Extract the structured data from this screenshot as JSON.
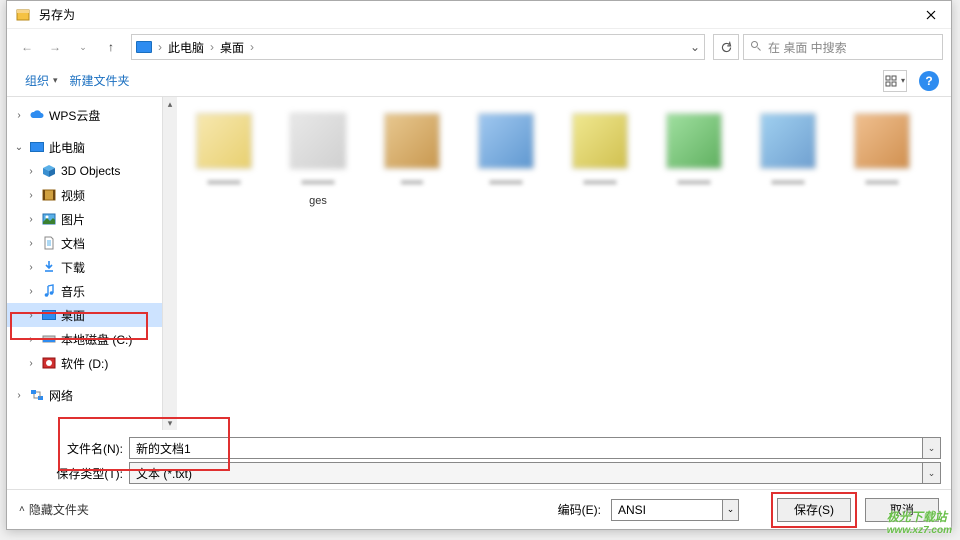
{
  "window": {
    "title": "另存为"
  },
  "breadcrumb": {
    "root": "此电脑",
    "current": "桌面"
  },
  "search": {
    "placeholder": "在 桌面 中搜索"
  },
  "toolbar": {
    "organize": "组织",
    "new_folder": "新建文件夹"
  },
  "sidebar": {
    "items": [
      {
        "label": "WPS云盘",
        "level": 0,
        "exp": "›",
        "icon": "cloud",
        "selected": false
      },
      {
        "label": "此电脑",
        "level": 0,
        "exp": "⌄",
        "icon": "pc",
        "selected": false
      },
      {
        "label": "3D Objects",
        "level": 1,
        "exp": "›",
        "icon": "3d",
        "selected": false
      },
      {
        "label": "视频",
        "level": 1,
        "exp": "›",
        "icon": "video",
        "selected": false
      },
      {
        "label": "图片",
        "level": 1,
        "exp": "›",
        "icon": "pic",
        "selected": false
      },
      {
        "label": "文档",
        "level": 1,
        "exp": "›",
        "icon": "doc",
        "selected": false
      },
      {
        "label": "下载",
        "level": 1,
        "exp": "›",
        "icon": "download",
        "selected": false
      },
      {
        "label": "音乐",
        "level": 1,
        "exp": "›",
        "icon": "music",
        "selected": false
      },
      {
        "label": "桌面",
        "level": 1,
        "exp": "›",
        "icon": "desktop",
        "selected": true,
        "highlighted": true
      },
      {
        "label": "本地磁盘 (C:)",
        "level": 1,
        "exp": "›",
        "icon": "drive",
        "selected": false
      },
      {
        "label": "软件 (D:)",
        "level": 1,
        "exp": "›",
        "icon": "drive-red",
        "selected": false
      },
      {
        "label": "网络",
        "level": 0,
        "exp": "›",
        "icon": "network",
        "selected": false
      }
    ]
  },
  "files": {
    "ges_label": "ges"
  },
  "form": {
    "filename_label": "文件名(N):",
    "filename_value": "新的文档1",
    "filetype_label": "保存类型(T):",
    "filetype_value": "文本 (*.txt)"
  },
  "bottom": {
    "hide_folders": "隐藏文件夹",
    "encoding_label": "编码(E):",
    "encoding_value": "ANSI",
    "save": "保存(S)",
    "cancel": "取消"
  },
  "watermark": {
    "line1": "极光下载站",
    "line2": "www.xz7.com"
  }
}
